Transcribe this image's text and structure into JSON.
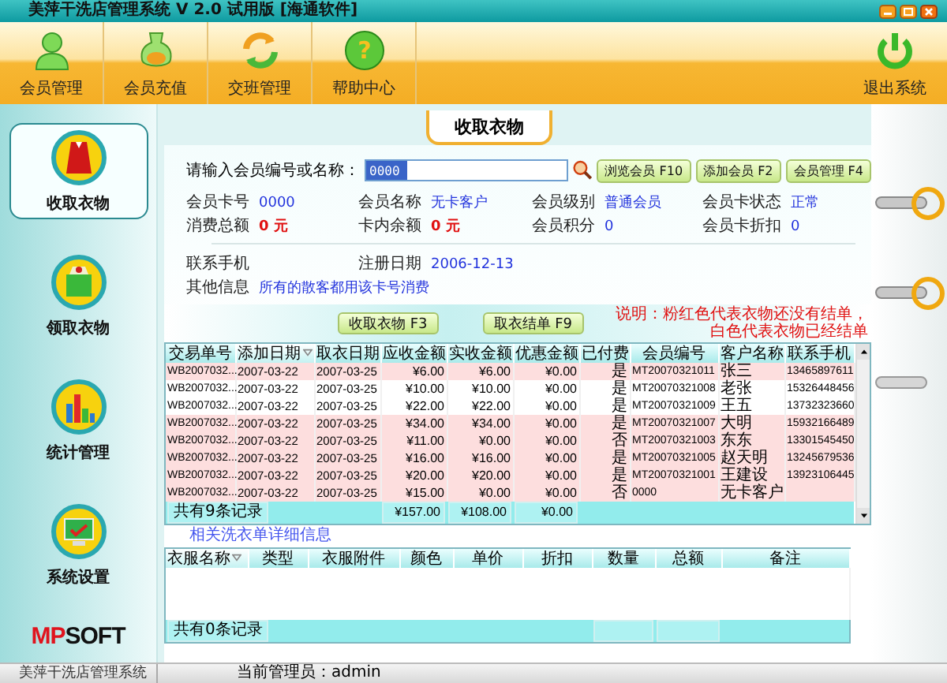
{
  "window": {
    "title": "美萍干洗店管理系统 V 2.0 试用版 [海通软件]"
  },
  "toolbar": {
    "items": [
      {
        "label": "会员管理"
      },
      {
        "label": "会员充值"
      },
      {
        "label": "交班管理"
      },
      {
        "label": "帮助中心",
        "glyph": "?"
      }
    ],
    "exit": {
      "label": "退出系统"
    }
  },
  "sidebar": {
    "items": [
      {
        "label": "收取衣物",
        "selected": true
      },
      {
        "label": "领取衣物",
        "selected": false
      },
      {
        "label": "统计管理",
        "selected": false
      },
      {
        "label": "系统设置",
        "selected": false
      }
    ],
    "logo": "MPSOFT"
  },
  "page": {
    "title": "收取衣物"
  },
  "search": {
    "label": "请输入会员编号或名称：",
    "value": "0000",
    "buttons": [
      "浏览会员 F10",
      "添加会员 F2",
      "会员管理 F4"
    ]
  },
  "member": [
    {
      "label": "会员卡号",
      "value": "0000",
      "kind": "plain"
    },
    {
      "label": "会员名称",
      "value": "无卡客户",
      "kind": "plain"
    },
    {
      "label": "会员级别",
      "value": "普通会员",
      "kind": "plain"
    },
    {
      "label": "会员卡状态",
      "value": "正常",
      "kind": "plain"
    },
    {
      "label": "消费总额",
      "value": "0 元",
      "kind": "amount"
    },
    {
      "label": "卡内余额",
      "value": "0 元",
      "kind": "amount"
    },
    {
      "label": "会员积分",
      "value": "0",
      "kind": "plain"
    },
    {
      "label": "会员卡折扣",
      "value": "0",
      "kind": "plain"
    }
  ],
  "contact": [
    {
      "label": "联系手机",
      "kind": "plain"
    },
    {
      "label": "注册日期",
      "value": "2006-12-13",
      "kind": "plain"
    },
    {
      "label": "其他信息",
      "value": "所有的散客都用该卡号消费",
      "kind": "note"
    }
  ],
  "actions": {
    "buttons": [
      "收取衣物 F3",
      "取衣结单 F9"
    ],
    "note": [
      "说明：粉红色代表衣物还没有结单，",
      "白色代表衣物已经结单"
    ]
  },
  "orders": {
    "columns": [
      {
        "label": "交易单号",
        "kind": "code",
        "sorted": false
      },
      {
        "label": "添加日期",
        "kind": "date",
        "sorted": true
      },
      {
        "label": "取衣日期",
        "kind": "date",
        "sorted": false
      },
      {
        "label": "应收金额",
        "kind": "money",
        "sorted": false
      },
      {
        "label": "实收金额",
        "kind": "money",
        "sorted": false
      },
      {
        "label": "优惠金额",
        "kind": "money",
        "sorted": false
      },
      {
        "label": "已付费",
        "kind": "flag",
        "sorted": false
      },
      {
        "label": "会员编号",
        "kind": "code",
        "sorted": false
      },
      {
        "label": "客户名称",
        "kind": "name",
        "sorted": false
      },
      {
        "label": "联系手机",
        "kind": "code",
        "sorted": false
      }
    ],
    "rows": [
      {
        "settled": false,
        "cells": [
          "WB2007032...",
          "2007-03-22",
          "2007-03-25",
          "¥6.00",
          "¥6.00",
          "¥0.00",
          "是",
          "MT20070321011",
          "张三",
          "13465897611"
        ]
      },
      {
        "settled": true,
        "cells": [
          "WB2007032...",
          "2007-03-22",
          "2007-03-25",
          "¥10.00",
          "¥10.00",
          "¥0.00",
          "是",
          "MT20070321008",
          "老张",
          "15326448456"
        ]
      },
      {
        "settled": true,
        "cells": [
          "WB2007032...",
          "2007-03-22",
          "2007-03-25",
          "¥22.00",
          "¥22.00",
          "¥0.00",
          "是",
          "MT20070321009",
          "王五",
          "13732323660"
        ]
      },
      {
        "settled": false,
        "cells": [
          "WB2007032...",
          "2007-03-22",
          "2007-03-25",
          "¥34.00",
          "¥34.00",
          "¥0.00",
          "是",
          "MT20070321007",
          "大明",
          "15932166489"
        ]
      },
      {
        "settled": false,
        "cells": [
          "WB2007032...",
          "2007-03-22",
          "2007-03-25",
          "¥11.00",
          "¥0.00",
          "¥0.00",
          "否",
          "MT20070321003",
          "东东",
          "13301545450"
        ]
      },
      {
        "settled": false,
        "cells": [
          "WB2007032...",
          "2007-03-22",
          "2007-03-25",
          "¥16.00",
          "¥16.00",
          "¥0.00",
          "是",
          "MT20070321005",
          "赵天明",
          "13245679536"
        ]
      },
      {
        "settled": false,
        "cells": [
          "WB2007032...",
          "2007-03-22",
          "2007-03-25",
          "¥20.00",
          "¥20.00",
          "¥0.00",
          "是",
          "MT20070321001",
          "王建设",
          "13923106445"
        ]
      },
      {
        "settled": false,
        "cells": [
          "WB2007032...",
          "2007-03-22",
          "2007-03-25",
          "¥15.00",
          "¥0.00",
          "¥0.00",
          "否",
          "0000",
          "无卡客户",
          ""
        ]
      }
    ],
    "footer": {
      "count": "共有9条记录",
      "totals": [
        "¥157.00",
        "¥108.00",
        "¥0.00"
      ]
    }
  },
  "details": {
    "caption": "相关洗衣单详细信息",
    "columns": [
      {
        "label": "衣服名称",
        "sorted": true
      },
      {
        "label": "类型",
        "sorted": false
      },
      {
        "label": "衣服附件",
        "sorted": false
      },
      {
        "label": "颜色",
        "sorted": false
      },
      {
        "label": "单价",
        "sorted": false
      },
      {
        "label": "折扣",
        "sorted": false
      },
      {
        "label": "数量",
        "sorted": false
      },
      {
        "label": "总额",
        "sorted": false
      },
      {
        "label": "备注",
        "sorted": false
      }
    ],
    "footer": {
      "count": "共有0条记录"
    }
  },
  "status_bar": {
    "app": "美萍干洗店管理系统",
    "user": "当前管理员：admin"
  }
}
